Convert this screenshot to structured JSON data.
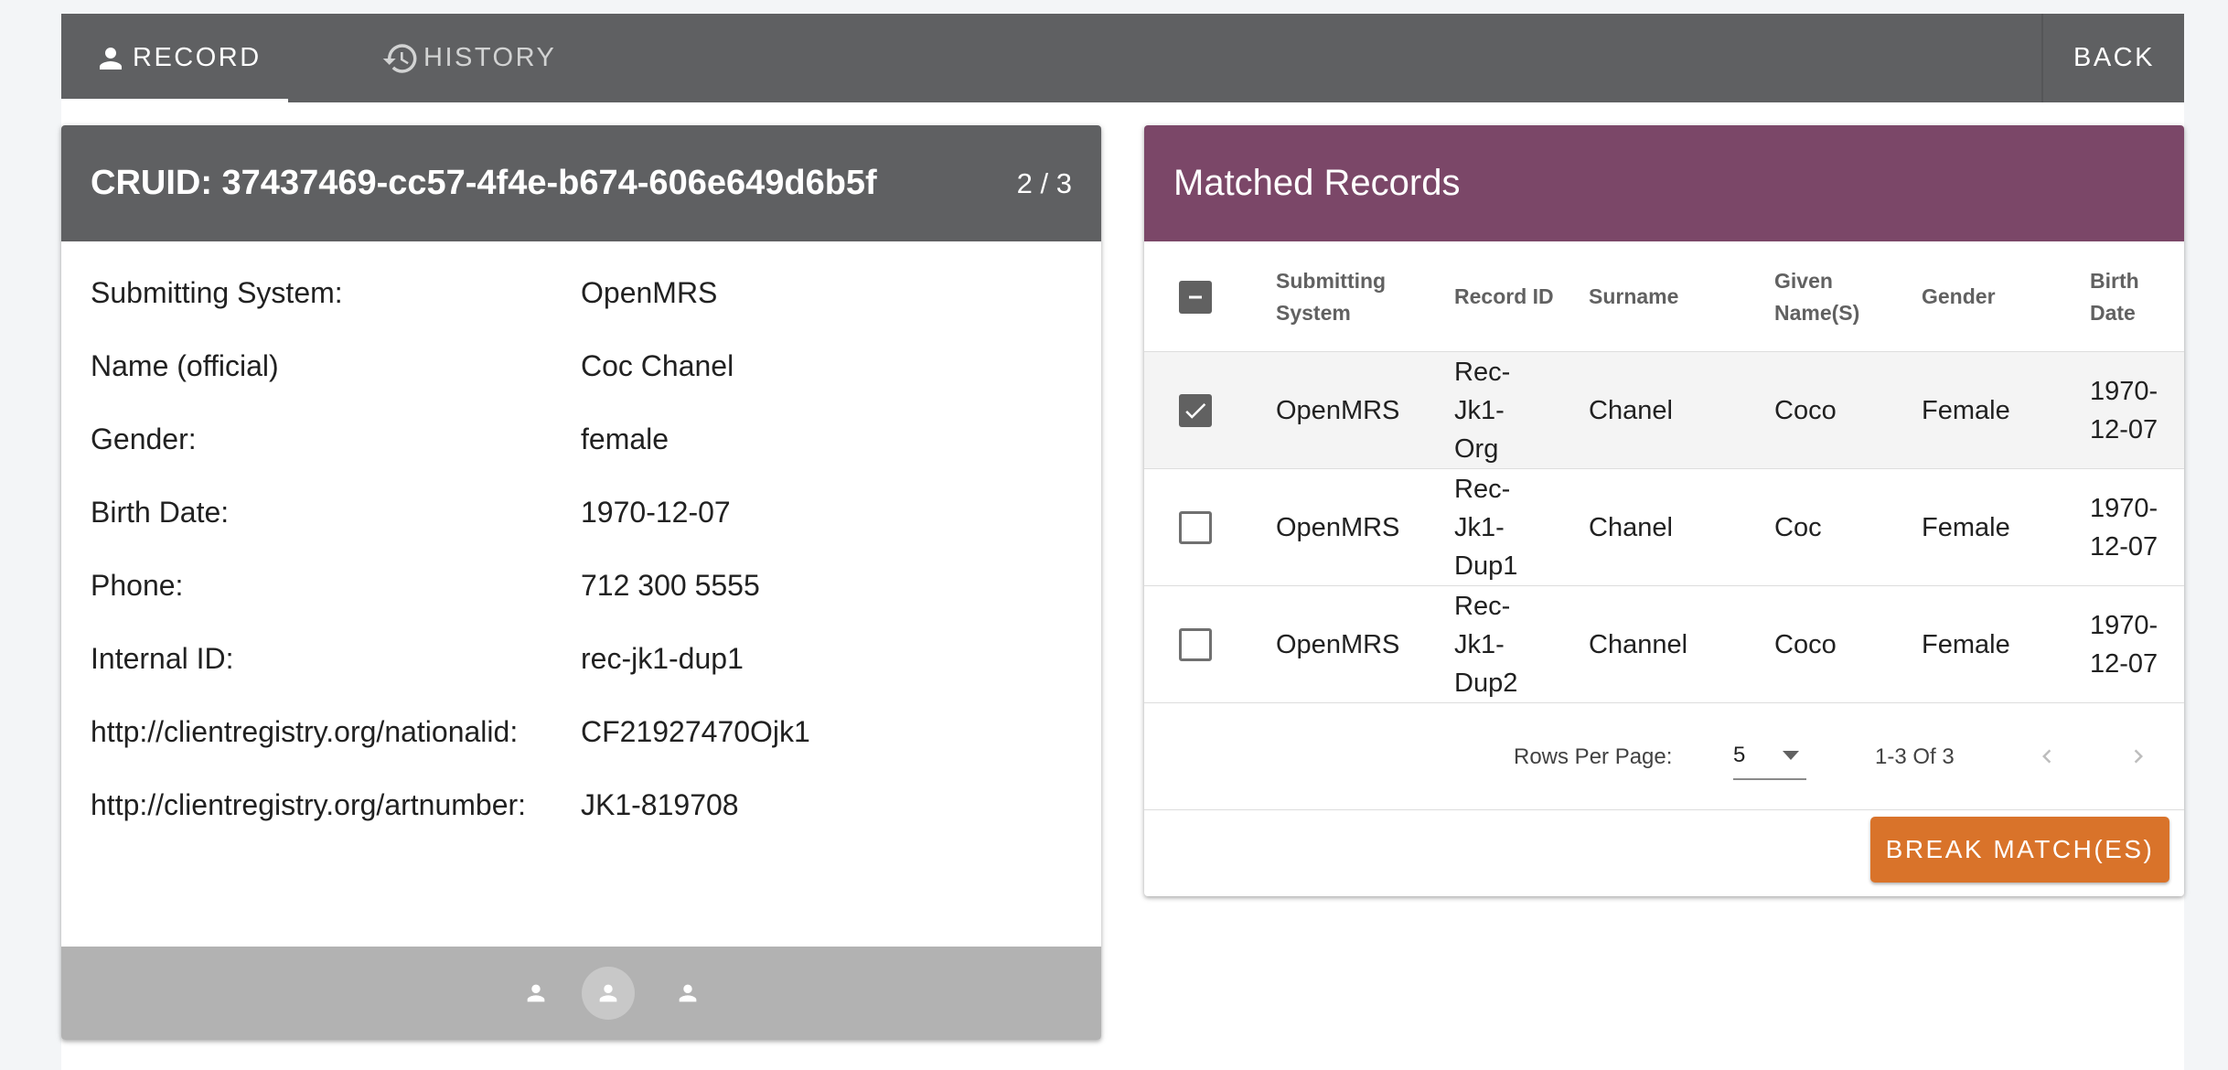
{
  "tabs": [
    {
      "label": "RECORD",
      "icon": "person-icon",
      "active": true
    },
    {
      "label": "HISTORY",
      "icon": "history-icon",
      "active": false
    }
  ],
  "back_label": "BACK",
  "record": {
    "title": "CRUID: 37437469-cc57-4f4e-b674-606e649d6b5f",
    "counter": "2 / 3",
    "fields": [
      {
        "label": "Submitting System:",
        "value": "OpenMRS"
      },
      {
        "label": "Name (official)",
        "value": "Coc Chanel"
      },
      {
        "label": "Gender:",
        "value": "female"
      },
      {
        "label": "Birth Date:",
        "value": "1970-12-07"
      },
      {
        "label": "Phone:",
        "value": "712 300 5555"
      },
      {
        "label": "Internal ID:",
        "value": "rec-jk1-dup1"
      },
      {
        "label": "http://clientregistry.org/nationalid:",
        "value": "CF21927470Ojk1"
      },
      {
        "label": "http://clientregistry.org/artnumber:",
        "value": "JK1-819708"
      }
    ],
    "pagination": {
      "count": 3,
      "active_index": 1
    }
  },
  "matched": {
    "title": "Matched Records",
    "columns": [
      "Submitting System",
      "Record ID",
      "Surname",
      "Given Name(S)",
      "Gender",
      "Birth Date"
    ],
    "rows": [
      {
        "checked": true,
        "system": "OpenMRS",
        "record_id": "Rec-Jk1-Org",
        "surname": "Chanel",
        "given": "Coco",
        "gender": "Female",
        "birth": "1970-12-07"
      },
      {
        "checked": false,
        "system": "OpenMRS",
        "record_id": "Rec-Jk1-Dup1",
        "surname": "Chanel",
        "given": "Coc",
        "gender": "Female",
        "birth": "1970-12-07"
      },
      {
        "checked": false,
        "system": "OpenMRS",
        "record_id": "Rec-Jk1-Dup2",
        "surname": "Channel",
        "given": "Coco",
        "gender": "Female",
        "birth": "1970-12-07"
      }
    ],
    "rows_per_page_label": "Rows Per Page:",
    "rows_per_page_value": "5",
    "range_label": "1-3 Of 3",
    "break_label": "BREAK MATCH(ES)"
  },
  "colors": {
    "toolbar": "#5f6062",
    "matched_header": "#7b4768",
    "break_button": "#d9732a",
    "footer": "#b2b2b2"
  }
}
